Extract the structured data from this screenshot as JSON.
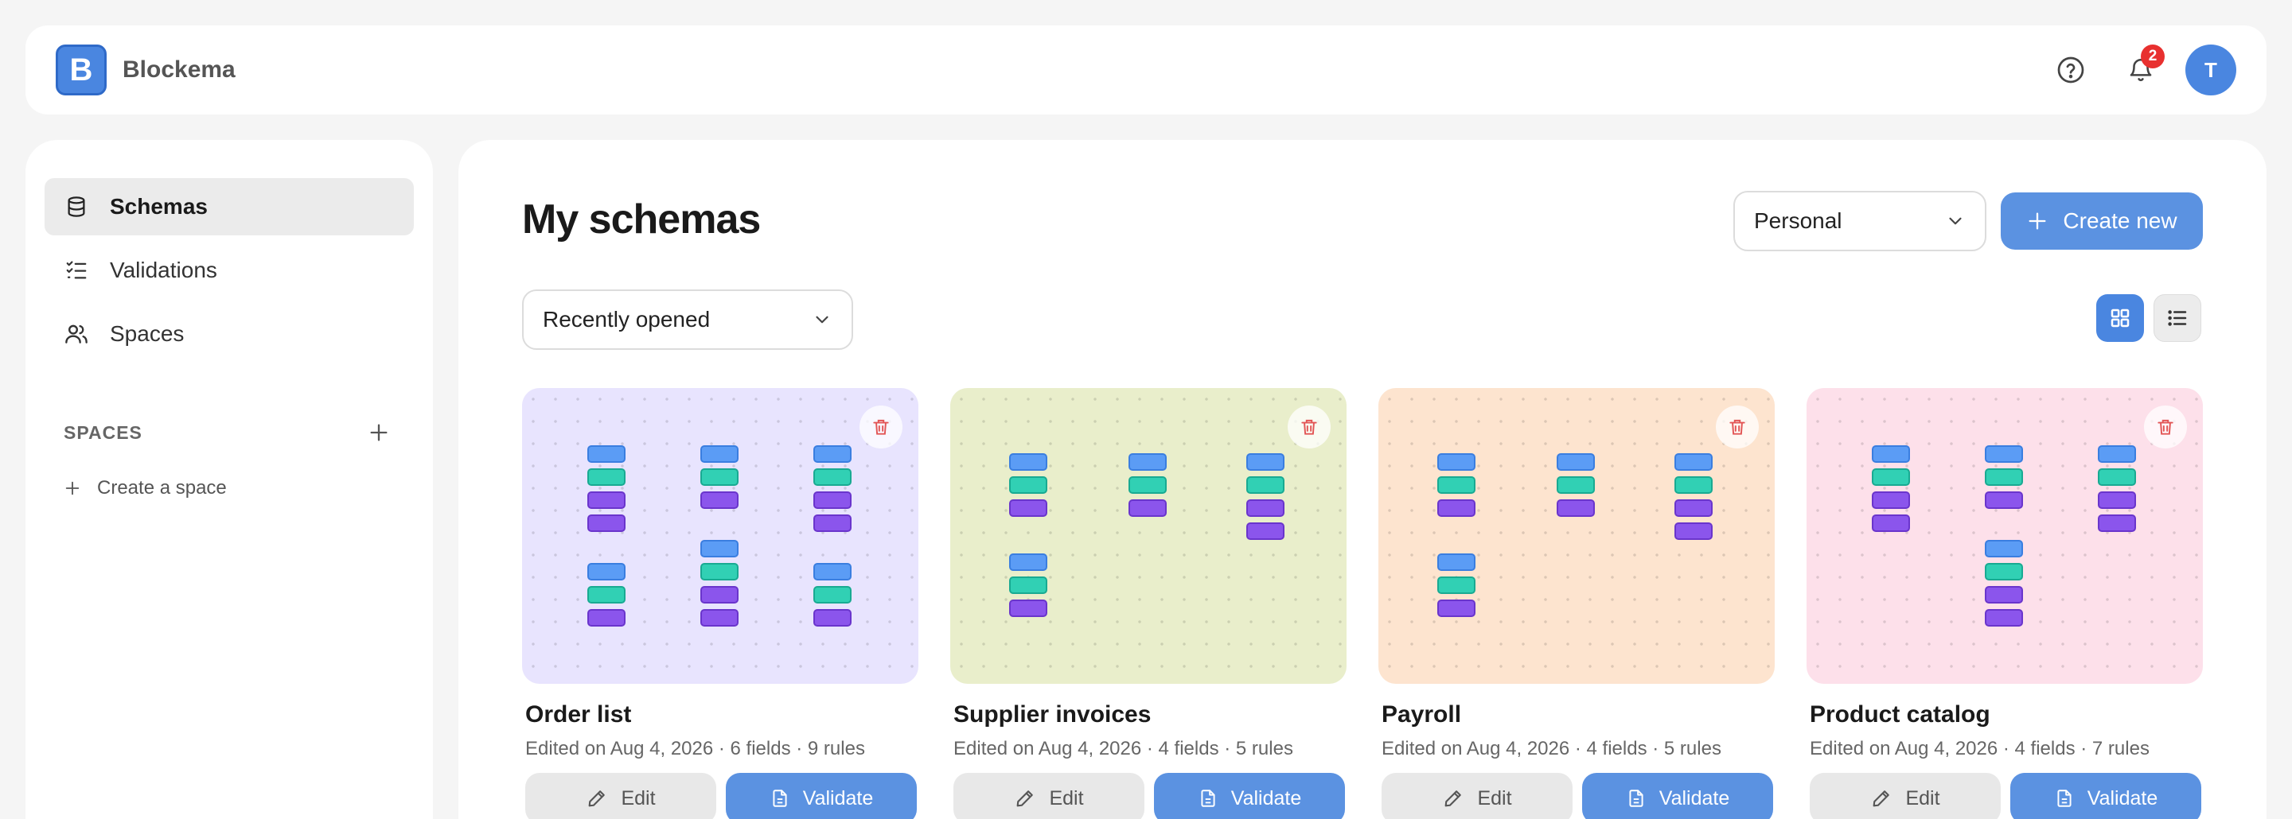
{
  "app": {
    "logo_letter": "B",
    "name": "Blockema"
  },
  "header": {
    "notification_count": "2",
    "avatar_initial": "T"
  },
  "sidebar": {
    "items": [
      {
        "label": "Schemas",
        "icon": "database-icon",
        "active": true
      },
      {
        "label": "Validations",
        "icon": "checklist-icon",
        "active": false
      },
      {
        "label": "Spaces",
        "icon": "users-icon",
        "active": false
      }
    ],
    "spaces_heading": "SPACES",
    "create_space_label": "Create a space"
  },
  "main": {
    "title": "My schemas",
    "workspace_select": "Personal",
    "create_label": "Create new",
    "sort_select": "Recently opened",
    "view_mode": "grid"
  },
  "cards": [
    {
      "title": "Order list",
      "meta": "Edited on Aug 4, 2026 · 6 fields · 9 rules",
      "bg": "#e8e4fe",
      "edit_label": "Edit",
      "validate_label": "Validate"
    },
    {
      "title": "Supplier invoices",
      "meta": "Edited on Aug 4, 2026 · 4 fields · 5 rules",
      "bg": "#e9eecb",
      "edit_label": "Edit",
      "validate_label": "Validate"
    },
    {
      "title": "Payroll",
      "meta": "Edited on Aug 4, 2026 · 4 fields · 5 rules",
      "bg": "#fde4cf",
      "edit_label": "Edit",
      "validate_label": "Validate"
    },
    {
      "title": "Product catalog",
      "meta": "Edited on Aug 4, 2026 · 4 fields · 7 rules",
      "bg": "#fde0ea",
      "edit_label": "Edit",
      "validate_label": "Validate"
    }
  ],
  "colors": {
    "accent": "#4a86e0",
    "button": "#5b92e1",
    "badge": "#e8302f",
    "block_blue": "#5b9cf5",
    "block_teal": "#31d0b4",
    "block_purple": "#8b55ec"
  }
}
